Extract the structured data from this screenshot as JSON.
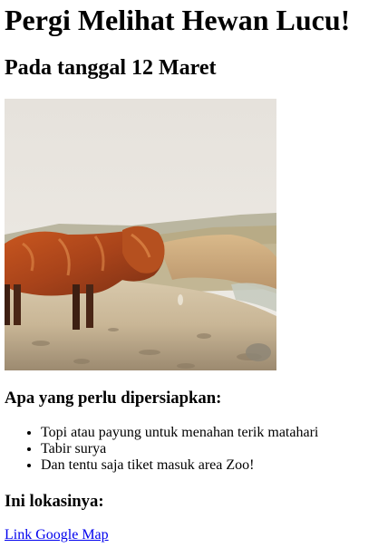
{
  "header": {
    "title": "Pergi Melihat Hewan Lucu!",
    "subtitle": "Pada tanggal 12 Maret"
  },
  "photo": {
    "subject": "highland-cow-on-hillside"
  },
  "preparation": {
    "heading": "Apa yang perlu dipersiapkan:",
    "items": [
      {
        "label": "Topi atau payung untuk menahan terik matahari"
      },
      {
        "label": "Tabir surya"
      },
      {
        "label": "Dan tentu saja tiket masuk area Zoo!"
      }
    ]
  },
  "location": {
    "heading": "Ini lokasinya:",
    "link_label": "Link Google Map"
  },
  "colors": {
    "link": "#0000ee",
    "text": "#000000",
    "background": "#ffffff"
  }
}
